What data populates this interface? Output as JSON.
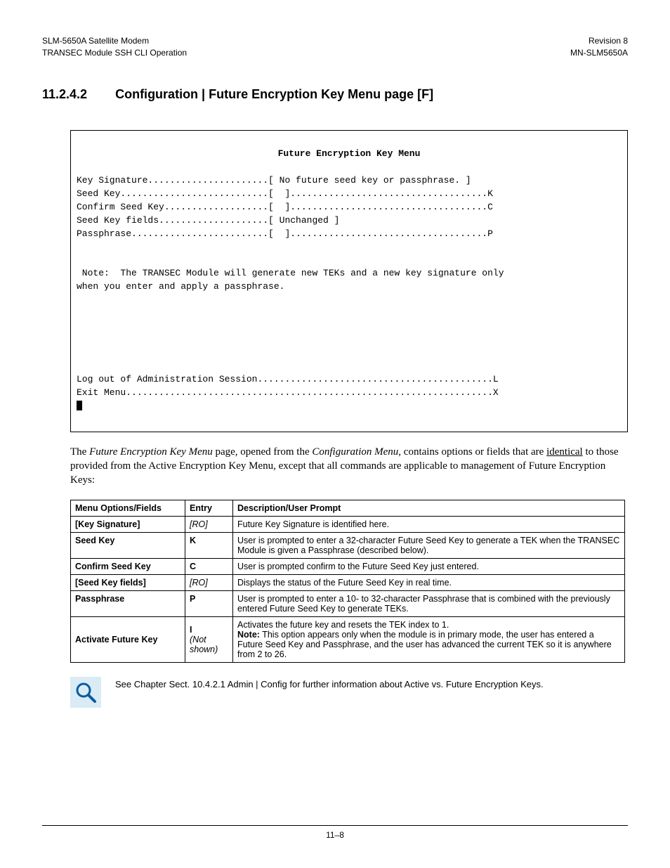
{
  "header": {
    "left1": "SLM-5650A Satellite Modem",
    "left2": "TRANSEC Module SSH CLI Operation",
    "right1": "Revision 8",
    "right2": "MN-SLM5650A"
  },
  "heading": {
    "number": "11.2.4.2",
    "title": "Configuration | Future Encryption Key Menu page [F]"
  },
  "terminal": {
    "title": "Future Encryption Key Menu",
    "line1": "Key Signature......................[ No future seed key or passphrase. ]",
    "line2": "Seed Key...........................[  ]....................................K",
    "line3": "Confirm Seed Key...................[  ]....................................C",
    "line4": "Seed Key fields....................[ Unchanged ]",
    "line5": "Passphrase.........................[  ]....................................P",
    "note": " Note:  The TRANSEC Module will generate new TEKs and a new key signature only\nwhen you enter and apply a passphrase.",
    "line6": "Log out of Administration Session...........................................L",
    "line7": "Exit Menu...................................................................X"
  },
  "body": {
    "p1a": "The ",
    "p1b": "Future Encryption Key Menu",
    "p1c": " page, opened from the ",
    "p1d": "Configuration Menu",
    "p1e": ", contains options or fields that are ",
    "p1f": "identical",
    "p1g": " to those provided from the Active Encryption Key Menu, except that all commands are applicable to management of Future Encryption Keys:"
  },
  "table": {
    "h1": "Menu Options/Fields",
    "h2": "Entry",
    "h3": "Description/User Prompt",
    "rows": [
      {
        "opt": "[Key Signature]",
        "entry": "[RO]",
        "entry_style": "ro",
        "desc": "Future Key Signature is identified here."
      },
      {
        "opt": "Seed Key",
        "entry": "K",
        "desc": "User is prompted to enter a 32-character Future Seed Key to generate a TEK when the TRANSEC Module is given a Passphrase (described below)."
      },
      {
        "opt": "Confirm Seed Key",
        "entry": "C",
        "desc": "User is prompted confirm to the Future Seed Key just entered."
      },
      {
        "opt": "[Seed Key fields]",
        "entry": "[RO]",
        "entry_style": "ro",
        "desc": "Displays the status of the Future Seed Key in real time."
      },
      {
        "opt": "Passphrase",
        "entry": "P",
        "desc": "User is prompted to enter a 10- to 32-character Passphrase that is combined with the previously entered Future Seed Key to generate TEKs."
      },
      {
        "opt": "Activate Future Key",
        "entry": "I",
        "entry_sub": "(Not shown)",
        "desc_pre": "Activates the future key and resets the TEK index to 1.",
        "desc_bold": "Note:",
        "desc_post": " This option appears only when the module is in primary mode, the user has entered a Future Seed Key and Passphrase, and the user has advanced the current TEK so it is anywhere from 2 to 26."
      }
    ]
  },
  "refnote": "See Chapter Sect. 10.4.2.1 Admin | Config for further information about Active vs. Future Encryption Keys.",
  "footer": "11–8"
}
